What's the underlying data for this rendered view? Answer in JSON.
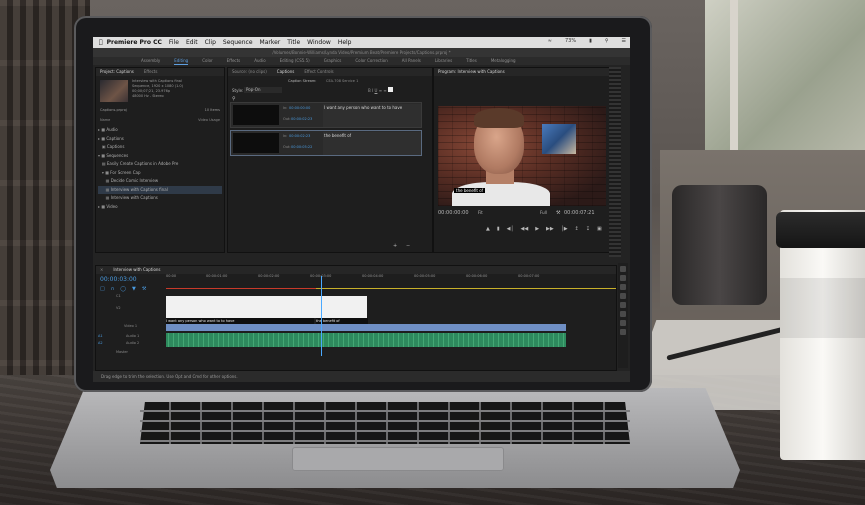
{
  "menubar": {
    "app": "Premiere Pro CC",
    "items": [
      "File",
      "Edit",
      "Clip",
      "Sequence",
      "Marker",
      "Title",
      "Window",
      "Help"
    ],
    "battery": "73%"
  },
  "titlebar": {
    "path": "/Volumes/Bonnie-Williams/Lynda Video/Premium Beat/Premiere Projects/Captions.prproj *"
  },
  "workspaces": [
    "Assembly",
    "Editing",
    "Color",
    "Effects",
    "Audio",
    "Editing (CS5.5)",
    "Graphics",
    "Color Correction",
    "All Panels",
    "Libraries",
    "Titles",
    "Metalogging"
  ],
  "project": {
    "tabs": [
      "Project: Captions",
      "Effects"
    ],
    "clip_name": "Interview with Captions final",
    "clip_meta": [
      "Sequence, 1920 x 1080 (1.0)",
      "00;00;07;21, 23.976p",
      "48000 Hz - Stereo"
    ],
    "project_file": "Captions.prproj",
    "item_count": "10 Items",
    "column": "Name",
    "column2": "Video Usage",
    "tree": [
      "Audio",
      "Captions",
      "Captions",
      "Sequences",
      "Easily Create Captions in Adobe Pre",
      "For Screen Cap",
      "Decide Comic Interview",
      "Interview with Captions final",
      "Interview with Captions",
      "Video"
    ]
  },
  "captions": {
    "tabs": [
      "Source: (no clips)",
      "Captions",
      "Effect Controls"
    ],
    "stream": "Caption Stream:",
    "stream_value": "CEA-708 Service 1",
    "style": "Style:",
    "style_value": "Pop-On",
    "rows": [
      {
        "in": "00:00:00:00",
        "out": "00:00:02:23",
        "text": "I want any person who want to to have"
      },
      {
        "in": "00:00:02:23",
        "out": "00:00:05:22",
        "text": "the benefit of"
      }
    ]
  },
  "program": {
    "tab": "Program: Interview with Captions",
    "caption_overlay": "the benefit of",
    "timecode_in": "00:00:00:00",
    "fit": "Fit",
    "zoom": "Full",
    "timecode_out": "00:00:07:21"
  },
  "timeline": {
    "tab": "Interview with Captions",
    "timecode": "00:00:03:00",
    "ruler": [
      "00:00",
      "00:00:01:00",
      "00:00:02:00",
      "00:00:03:00",
      "00:00:04:00",
      "00:00:05:00",
      "00:00:06:00",
      "00:00:07:00"
    ],
    "tracks": [
      "C1",
      "V2",
      "Video 1",
      "A1",
      "Audio 1",
      "A2",
      "Audio 2",
      "Master"
    ],
    "captions": [
      "I want any person who want to to have",
      "the benefit of"
    ]
  },
  "status": "Drag edge to trim the selection. Use Opt and Cmd for other options."
}
